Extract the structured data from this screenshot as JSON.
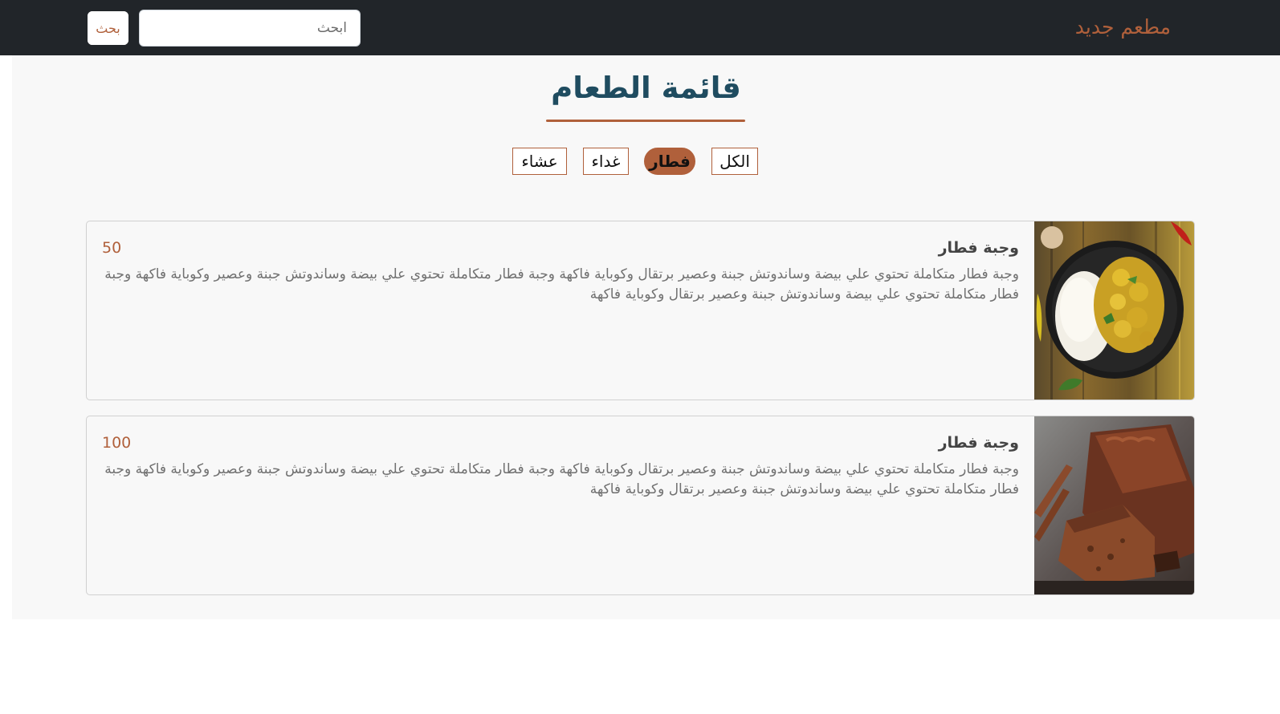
{
  "navbar": {
    "brand": "مطعم جديد",
    "search_placeholder": "ابحث",
    "search_value": "",
    "search_button_label": "بحث"
  },
  "page": {
    "title": "قائمة الطعام"
  },
  "filters": [
    {
      "label": "الكل",
      "active": false
    },
    {
      "label": "فطار",
      "active": true
    },
    {
      "label": "غداء",
      "active": false
    },
    {
      "label": "عشاء",
      "active": false
    }
  ],
  "menu_items": [
    {
      "title": "وجبة فطار",
      "price": "50",
      "description": "وجبة فطار متكاملة تحتوي علي بيضة وساندوتش جبنة وعصير برتقال وكوباية فاكهة وجبة فطار متكاملة تحتوي علي بيضة وساندوتش جبنة وعصير وكوباية فاكهة وجبة فطار متكاملة تحتوي علي بيضة وساندوتش جبنة وعصير برتقال وكوباية فاكهة",
      "image": "curry-rice-plate-photo"
    },
    {
      "title": "وجبة فطار",
      "price": "100",
      "description": "وجبة فطار متكاملة تحتوي علي بيضة وساندوتش جبنة وعصير برتقال وكوباية فاكهة وجبة فطار متكاملة تحتوي علي بيضة وساندوتش جبنة وعصير وكوباية فاكهة وجبة فطار متكاملة تحتوي علي بيضة وساندوتش جبنة وعصير برتقال وكوباية فاكهة",
      "image": "chocolate-loaf-cake-photo"
    }
  ],
  "colors": {
    "navbar_bg": "#212529",
    "accent": "#b0603b",
    "title": "#1f4c60",
    "page_bg": "#f8f8f8"
  }
}
